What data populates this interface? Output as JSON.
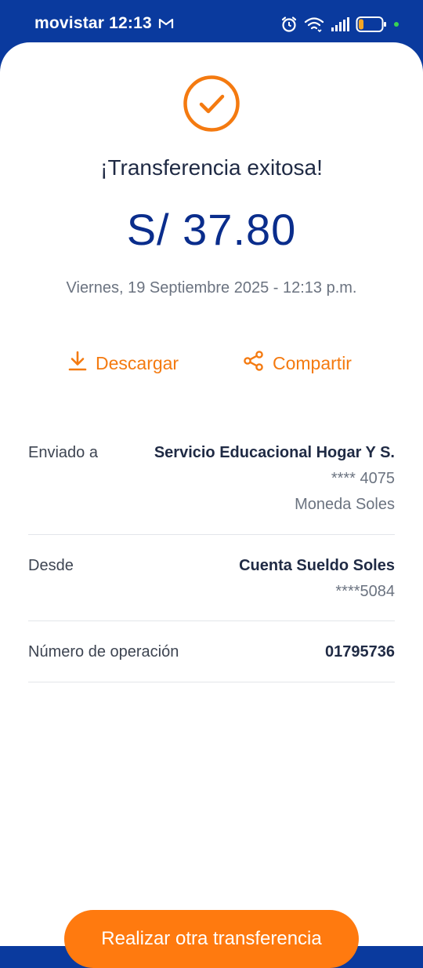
{
  "status_bar": {
    "carrier": "movistar",
    "time": "12:13",
    "notification_icons": [
      "gmail-icon"
    ],
    "system_icons": [
      "alarm-icon",
      "wifi-icon",
      "signal-icon",
      "battery-icon",
      "charging-dot-icon"
    ],
    "battery_level": 0.15
  },
  "colors": {
    "brand_blue": "#0a3a9e",
    "amount_blue": "#0a2d8c",
    "accent_orange": "#f47a10",
    "button_orange": "#ff7a0f",
    "text_dark": "#1f2a44",
    "text_muted": "#6b7380"
  },
  "result": {
    "icon": "check-circle-icon",
    "title": "¡Transferencia exitosa!",
    "amount": "S/ 37.80",
    "date": "Viernes, 19 Septiembre 2025 - 12:13 p.m."
  },
  "actions": {
    "download": {
      "icon": "download-icon",
      "label": "Descargar"
    },
    "share": {
      "icon": "share-icon",
      "label": "Compartir"
    }
  },
  "details": {
    "sent_to": {
      "label": "Enviado a",
      "name": "Servicio Educacional Hogar Y S.",
      "account": "**** 4075",
      "currency": "Moneda Soles"
    },
    "from": {
      "label": "Desde",
      "account_name": "Cuenta Sueldo Soles",
      "account_number": "****5084"
    },
    "operation": {
      "label": "Número de operación",
      "value": "01795736"
    }
  },
  "cta": {
    "label": "Realizar otra transferencia"
  }
}
